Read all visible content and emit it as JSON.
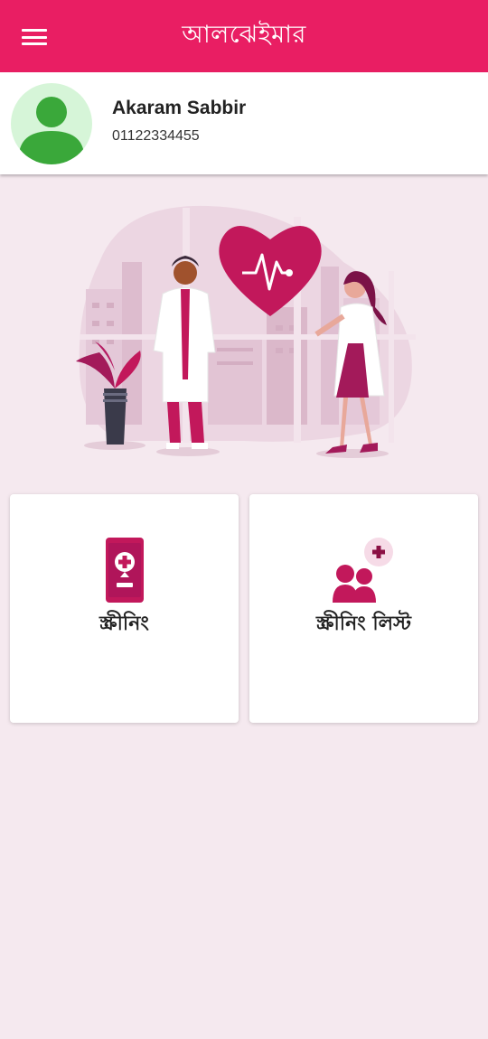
{
  "app": {
    "title": "আলঝেইমার",
    "accent_color": "#e91e63",
    "icon_color": "#c2185b"
  },
  "header": {
    "menu_icon": "hamburger-menu-icon"
  },
  "profile": {
    "name": "Akaram Sabbir",
    "phone": "01122334455",
    "avatar_icon": "user-avatar-icon"
  },
  "hero": {
    "illustration": "doctors-heart-illustration"
  },
  "cards": [
    {
      "label": "স্ক্রীনিং",
      "icon": "mobile-health-icon"
    },
    {
      "label": "স্ক্রীনিং লিস্ট",
      "icon": "patients-plus-icon"
    }
  ]
}
